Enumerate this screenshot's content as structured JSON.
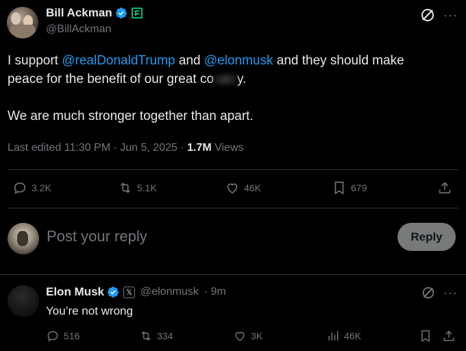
{
  "main_tweet": {
    "author_name": "Bill Ackman",
    "author_handle": "@BillAckman",
    "text_prefix": "I support ",
    "mention1": "@realDonaldTrump",
    "text_mid": " and ",
    "mention2": "@elonmusk",
    "text_suffix": " and they should make",
    "line2": "peace for the benefit of our great co",
    "line2_end": "y.",
    "line3": "We are much stronger together than apart.",
    "edited_prefix": "Last edited 11:30 PM · Jun 5, 2025 · ",
    "views_count": "1.7M",
    "views_label": " Views",
    "replies": "3.2K",
    "reposts": "5.1K",
    "likes": "46K",
    "bookmarks": "679"
  },
  "composer": {
    "placeholder": "Post your reply",
    "reply_label": "Reply"
  },
  "reply_tweet": {
    "author_name": "Elon Musk",
    "author_handle": "@elonmusk",
    "time": "· 9m",
    "text": "You’re not wrong",
    "replies": "516",
    "reposts": "334",
    "likes": "3K",
    "views": "46K"
  },
  "colors": {
    "accent": "#1d9bf0",
    "muted": "#71767b",
    "reply_button_bg": "#787a7a"
  }
}
